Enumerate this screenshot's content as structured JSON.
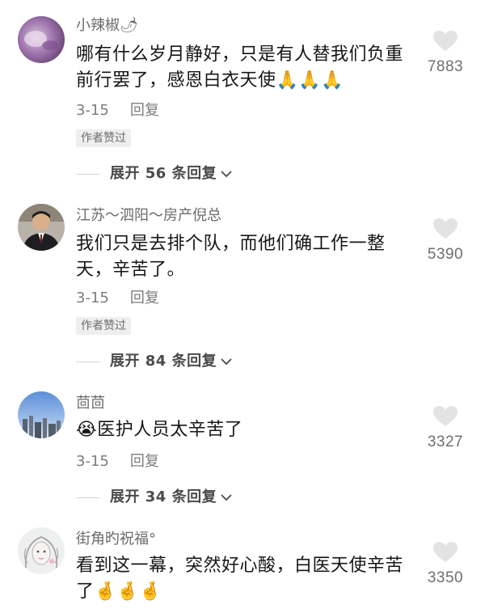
{
  "comments": [
    {
      "username": "小辣椒",
      "username_emoji": "🌶",
      "text_line1": "哪有什么岁月静好，只是有人替我们负重",
      "text_line2": "前行罢了，感恩白衣天使",
      "text_emojis": "🙏🙏🙏",
      "date": "3-15",
      "reply_label": "回复",
      "badge": "作者赞过",
      "expand_label": "展开 56 条回复",
      "likes": "7883",
      "avatar_icon": "purple-blur-avatar"
    },
    {
      "username": "江苏～泗阳～房产倪总",
      "text_line1": "我们只是去排个队，而他们确工作一整",
      "text_line2": "天，辛苦了。",
      "date": "3-15",
      "reply_label": "回复",
      "badge": "作者赞过",
      "expand_label": "展开 84 条回复",
      "likes": "5390",
      "avatar_icon": "man-in-suit-avatar"
    },
    {
      "username": "茴茴",
      "text_emoji": "😭",
      "text_line1": "医护人员太辛苦了",
      "date": "3-15",
      "reply_label": "回复",
      "expand_label": "展开 34 条回复",
      "likes": "3327",
      "avatar_icon": "city-skyline-avatar"
    },
    {
      "username": "街角旳祝福°",
      "text_line1": "看到这一幕，突然好心酸，白医天使辛苦",
      "text_line2": "了",
      "text_emojis": "🤞🤞🤞",
      "likes": "3350",
      "avatar_icon": "girl-sketch-avatar"
    }
  ],
  "colors": {
    "heart": "#e3e3e3",
    "muted_text": "#7d7d7d",
    "main_text": "#161616",
    "badge_bg": "#efefef"
  }
}
